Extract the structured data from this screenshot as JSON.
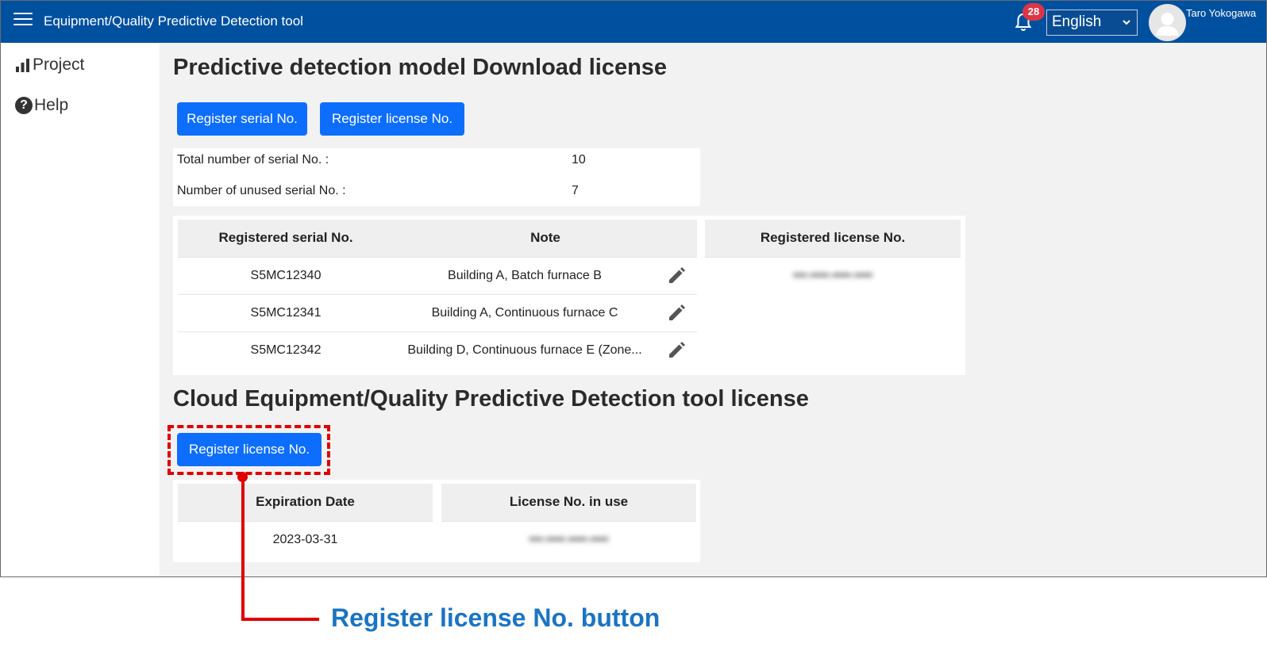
{
  "header": {
    "title": "Equipment/Quality Predictive Detection tool",
    "notification_count": "28",
    "language": "English",
    "user_name": "Taro Yokogawa",
    "bg_color": "#0050a0"
  },
  "sidebar": {
    "items": [
      {
        "label": "Project",
        "icon": "bar-chart-icon"
      },
      {
        "label": "Help",
        "icon": "help-icon"
      }
    ]
  },
  "download_section": {
    "title": "Predictive detection model Download license",
    "register_serial_label": "Register serial No.",
    "register_license_label": "Register license No.",
    "summary": {
      "total_label": "Total number of serial No. :",
      "total_value": "10",
      "unused_label": "Number of unused serial No. :",
      "unused_value": "7"
    },
    "serial_table": {
      "headers": [
        "Registered serial No.",
        "Note"
      ],
      "rows": [
        {
          "serial": "S5MC12340",
          "note": "Building A, Batch furnace B"
        },
        {
          "serial": "S5MC12341",
          "note": "Building A, Continuous furnace C"
        },
        {
          "serial": "S5MC12342",
          "note": "Building D, Continuous furnace E (Zone..."
        }
      ]
    },
    "license_table": {
      "header": "Registered license No.",
      "rows": [
        "•••-••••-••••-••••"
      ]
    }
  },
  "cloud_section": {
    "title": "Cloud Equipment/Quality Predictive Detection tool license",
    "register_license_label": "Register license No.",
    "table": {
      "headers": [
        "Expiration Date",
        "License No. in use"
      ],
      "expiration": "2023-03-31",
      "license_in_use": "•••-••••-••••-••••"
    }
  },
  "annotation": {
    "label": "Register license No. button",
    "color": "#e00000",
    "text_color": "#1a74c4"
  }
}
